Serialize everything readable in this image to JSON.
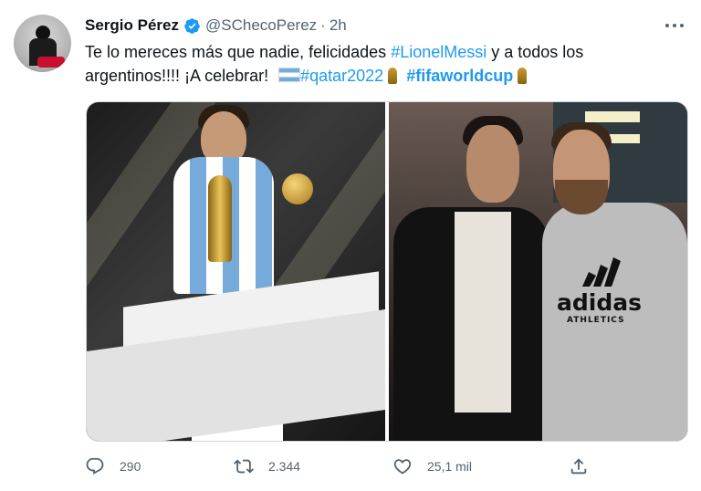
{
  "author": {
    "name": "Sergio Pérez",
    "handle": "@SChecoPerez",
    "separator": "·",
    "time": "2h"
  },
  "tweet": {
    "line1_text": "Te lo mereces más que nadie, felicidades ",
    "line1_tag": "#LionelMessi",
    "line1_rest": " y a todos los",
    "line2_text": "argentinos!!!! ¡A celebrar! ",
    "line2_tag1": "#qatar2022",
    "line2_tag2": "#fifaworldcup"
  },
  "media": {
    "photo2_logo_word": "adidas",
    "photo2_logo_sub": "ATHLETICS"
  },
  "actions": {
    "replies": "290",
    "retweets": "2.344",
    "likes": "25,1 mil"
  },
  "colors": {
    "accent": "#1d9bf0",
    "muted": "#536471",
    "text": "#0f1419"
  },
  "icons": [
    "verified-badge-icon",
    "more-options-icon",
    "argentina-flag-icon",
    "trophy-icon",
    "reply-icon",
    "retweet-icon",
    "like-icon",
    "share-icon"
  ]
}
